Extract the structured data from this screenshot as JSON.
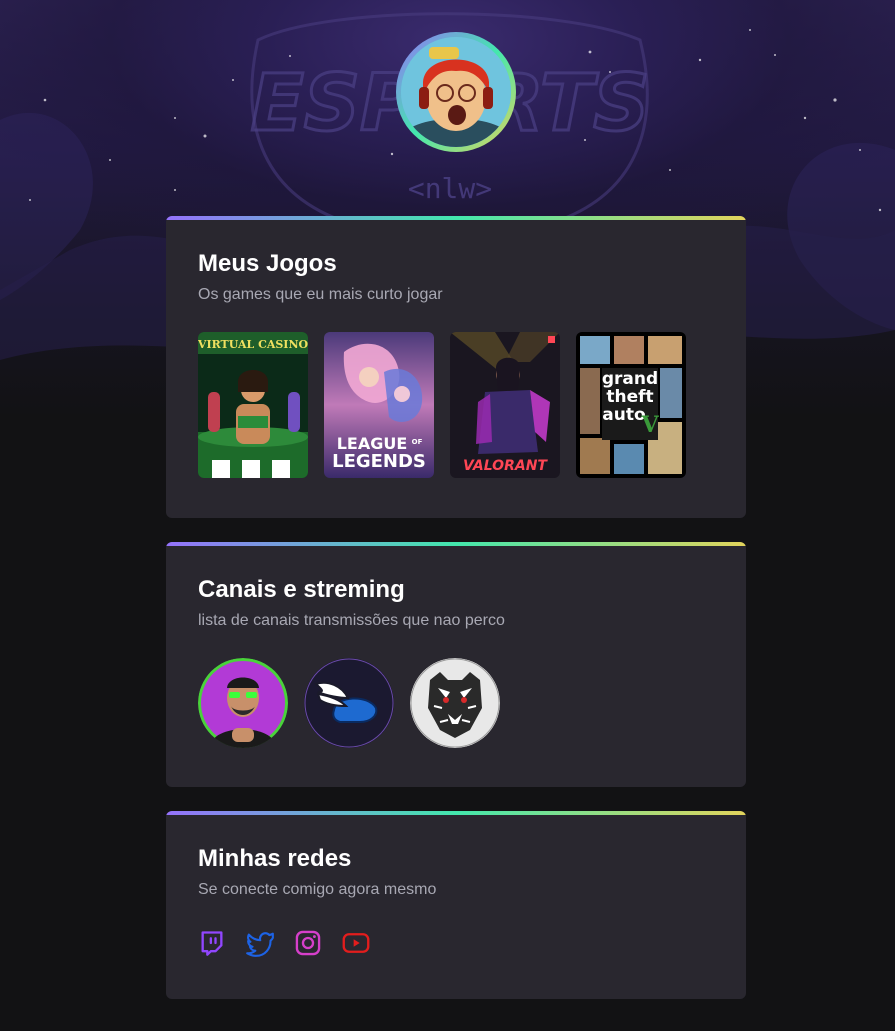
{
  "profile": {
    "avatar_icon": "gamer-avatar-icon"
  },
  "background": {
    "logo_text": "ESPORTS",
    "logo_subtext": "<nlw>"
  },
  "games_section": {
    "title": "Meus Jogos",
    "subtitle": "Os games que eu mais curto jogar",
    "games": [
      {
        "name": "Virtual Casino",
        "cover_text": "VIRTUAL CASINO"
      },
      {
        "name": "League of Legends",
        "cover_text_1": "LEAGUE",
        "cover_text_2": "OF",
        "cover_text_3": "LEGENDS"
      },
      {
        "name": "Valorant",
        "cover_text": "VALORANT"
      },
      {
        "name": "Grand Theft Auto V",
        "cover_text_1": "grand",
        "cover_text_2": "theft",
        "cover_text_3": "auto"
      }
    ]
  },
  "channels_section": {
    "title": "Canais e streming",
    "subtitle": "lista de canais transmissões que nao perco",
    "channels": [
      {
        "icon": "streamer-avatar-icon"
      },
      {
        "icon": "winged-helmet-icon"
      },
      {
        "icon": "tiger-icon"
      }
    ]
  },
  "socials_section": {
    "title": "Minhas redes",
    "subtitle": "Se conecte comigo agora mesmo",
    "links": [
      {
        "icon": "twitch-icon",
        "color": "#9146ff"
      },
      {
        "icon": "twitter-icon",
        "color": "#1d63e6"
      },
      {
        "icon": "instagram-icon",
        "color": "#d63fcb"
      },
      {
        "icon": "youtube-icon",
        "color": "#e31d1d"
      }
    ]
  },
  "colors": {
    "page_bg": "#121214",
    "card_bg": "#29272f",
    "gradient": [
      "#9572fc",
      "#43e7ad",
      "#e2d45c"
    ]
  }
}
